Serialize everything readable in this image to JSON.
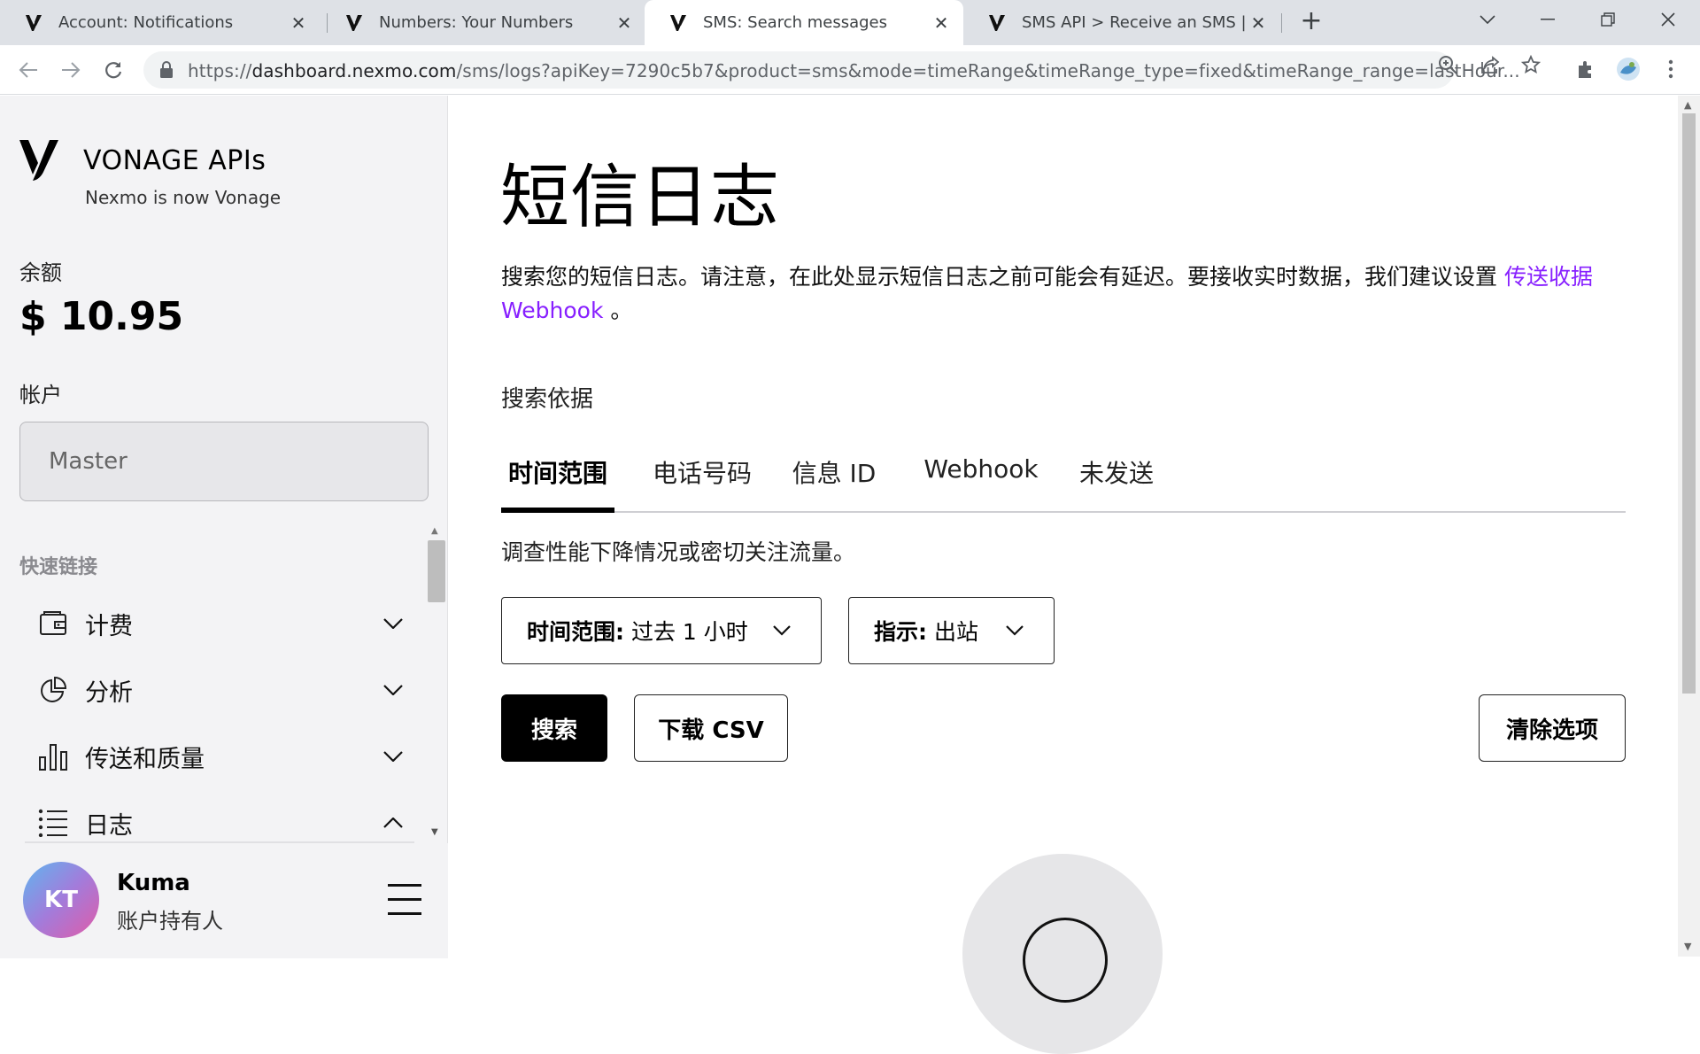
{
  "browser": {
    "tabs": [
      {
        "title": "Account: Notifications",
        "active": false
      },
      {
        "title": "Numbers: Your Numbers",
        "active": false
      },
      {
        "title": "SMS: Search messages",
        "active": true
      },
      {
        "title": "SMS API > Receive an SMS | Vona",
        "active": false
      }
    ],
    "new_tab_label": "+",
    "url_scheme": "https://",
    "url_domain": "dashboard.nexmo.com",
    "url_path": "/sms/logs?apiKey=7290c5b7&product=sms&mode=timeRange&timeRange_type=fixed&timeRange_range=lastHour..."
  },
  "sidebar": {
    "brand": "VONAGE APIs",
    "brand_sub": "Nexmo is now Vonage",
    "balance_label": "余额",
    "balance_value": "$ 10.95",
    "account_label": "帐户",
    "account_value": "Master",
    "quick_links_label": "快速链接",
    "items": [
      {
        "label": "计费",
        "icon": "wallet-icon",
        "expanded": false
      },
      {
        "label": "分析",
        "icon": "pie-chart-icon",
        "expanded": false
      },
      {
        "label": "传送和质量",
        "icon": "bar-chart-icon",
        "expanded": false
      },
      {
        "label": "日志",
        "icon": "list-icon",
        "expanded": true
      }
    ],
    "user": {
      "initials": "KT",
      "name": "Kuma",
      "role": "账户持有人"
    }
  },
  "main": {
    "title": "短信日志",
    "intro_text": "搜索您的短信日志。请注意，在此处显示短信日志之前可能会有延迟。要接收实时数据，我们建议设置",
    "intro_link": "传送收据 Webhook",
    "intro_end": "。",
    "search_by_label": "搜索依据",
    "tabs": [
      {
        "label": "时间范围",
        "active": true
      },
      {
        "label": "电话号码",
        "active": false
      },
      {
        "label": "信息 ID",
        "active": false
      },
      {
        "label": "Webhook",
        "active": false
      },
      {
        "label": "未发送",
        "active": false
      }
    ],
    "hint": "调查性能下降情况或密切关注流量。",
    "filters": {
      "time_range_label": "时间范围:",
      "time_range_value": "过去 1 小时",
      "direction_label": "指示:",
      "direction_value": "出站"
    },
    "buttons": {
      "search": "搜索",
      "download_csv": "下载 CSV",
      "clear": "清除选项"
    }
  },
  "colors": {
    "link": "#871fff",
    "sidebar_bg": "#f3f3f5",
    "primary_button": "#000000"
  }
}
